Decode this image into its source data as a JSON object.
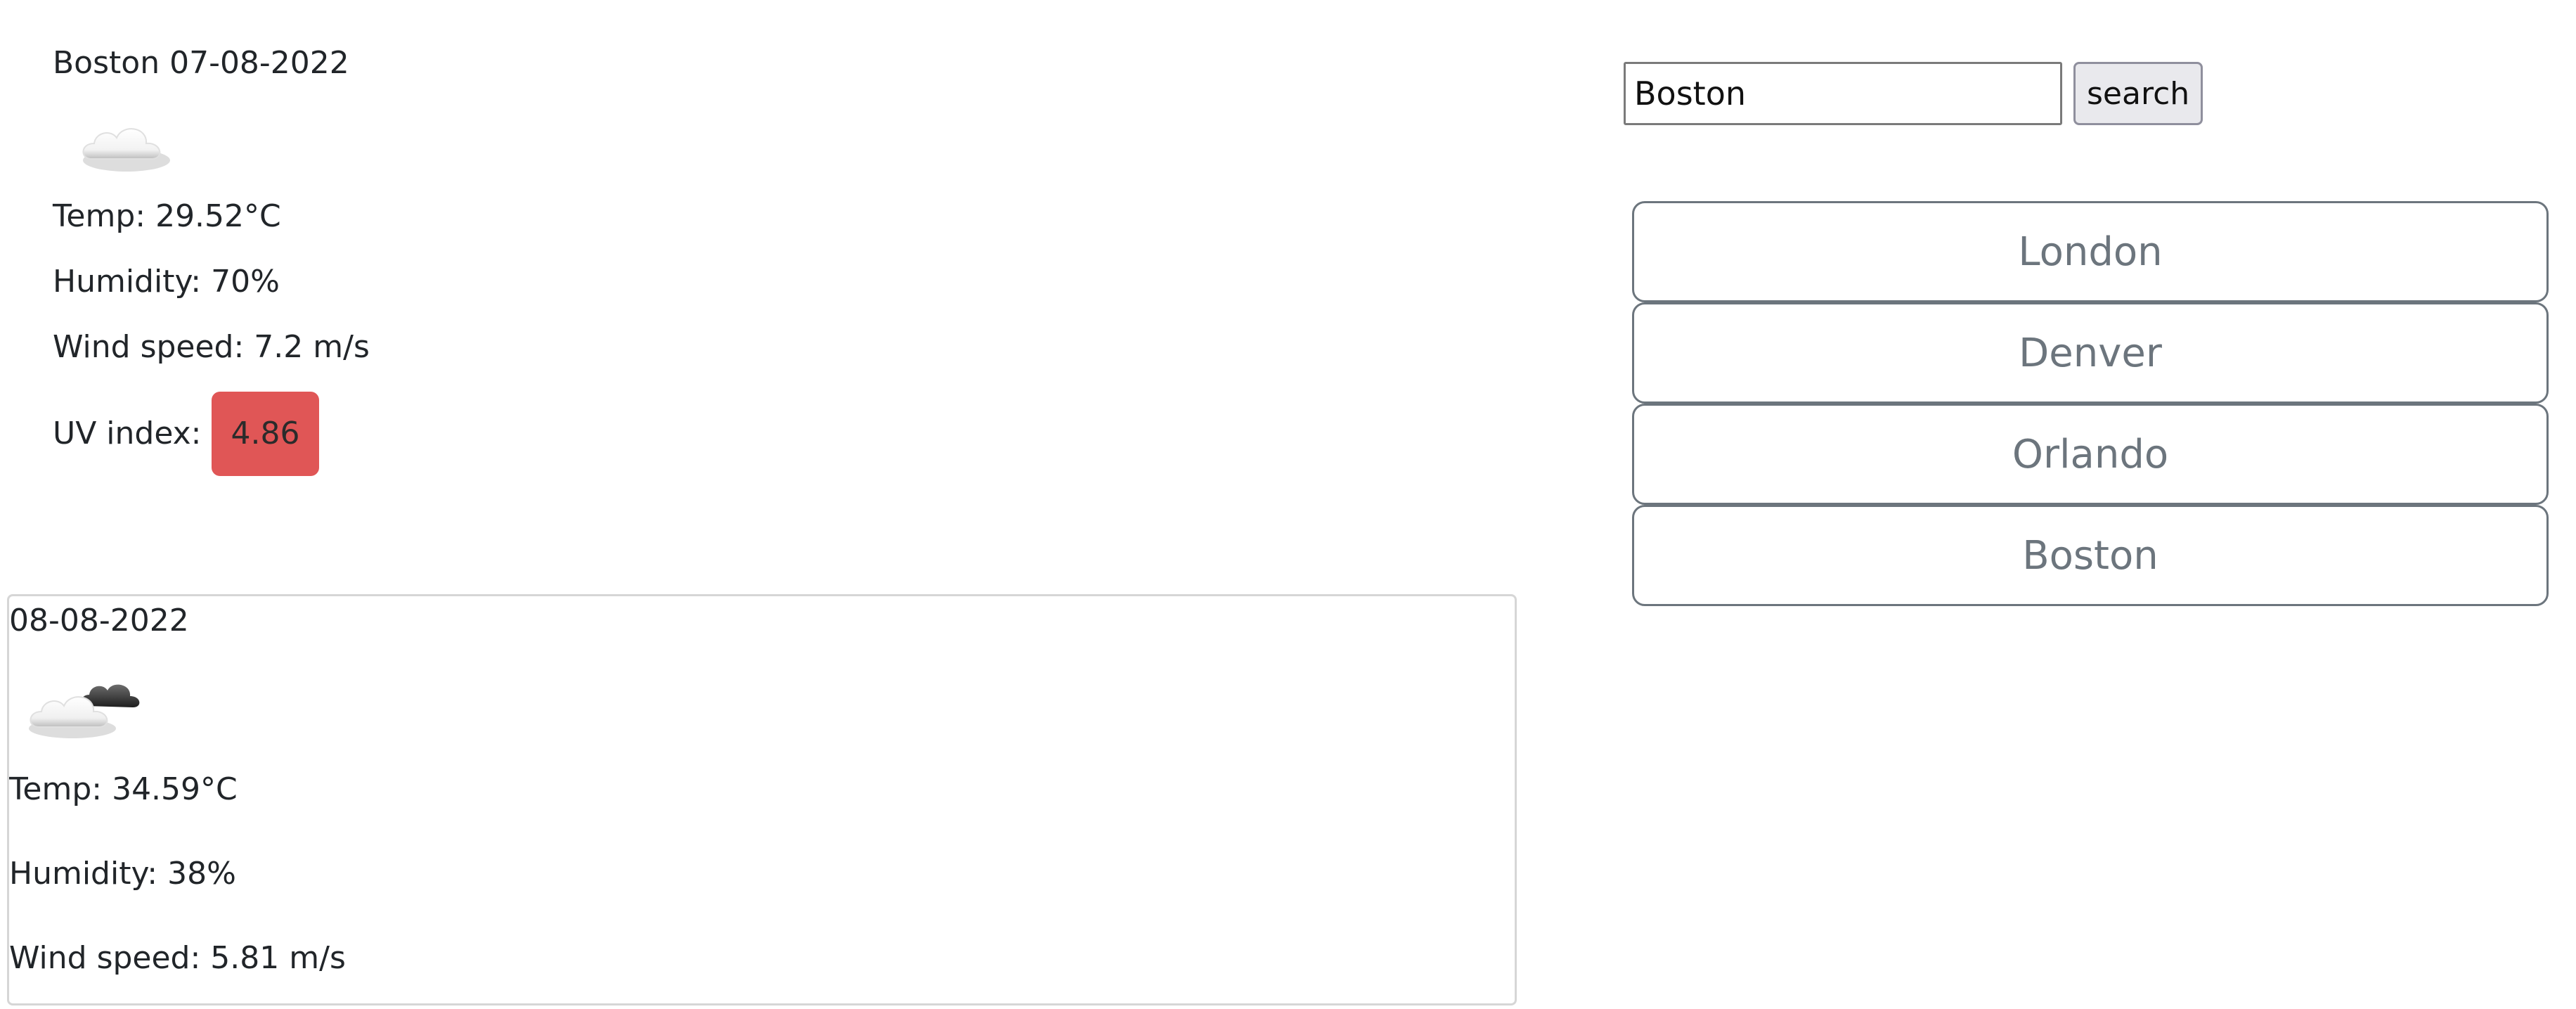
{
  "current": {
    "title": "Boston 07-08-2022",
    "icon": "cloud-icon",
    "temp": "Temp: 29.52°C",
    "humidity": "Humidity: 70%",
    "wind": "Wind speed: 7.2 m/s",
    "uv_label": "UV index:",
    "uv_value": "4.86",
    "uv_color": "#e05656"
  },
  "forecast": {
    "date": "08-08-2022",
    "icon": "partly-cloudy-icon",
    "temp": "Temp: 34.59°C",
    "humidity": "Humidity: 38%",
    "wind": "Wind speed: 5.81 m/s"
  },
  "search": {
    "value": "Boston",
    "button_label": "search"
  },
  "history": {
    "items": [
      {
        "label": "London"
      },
      {
        "label": "Denver"
      },
      {
        "label": "Orlando"
      },
      {
        "label": "Boston"
      }
    ]
  }
}
